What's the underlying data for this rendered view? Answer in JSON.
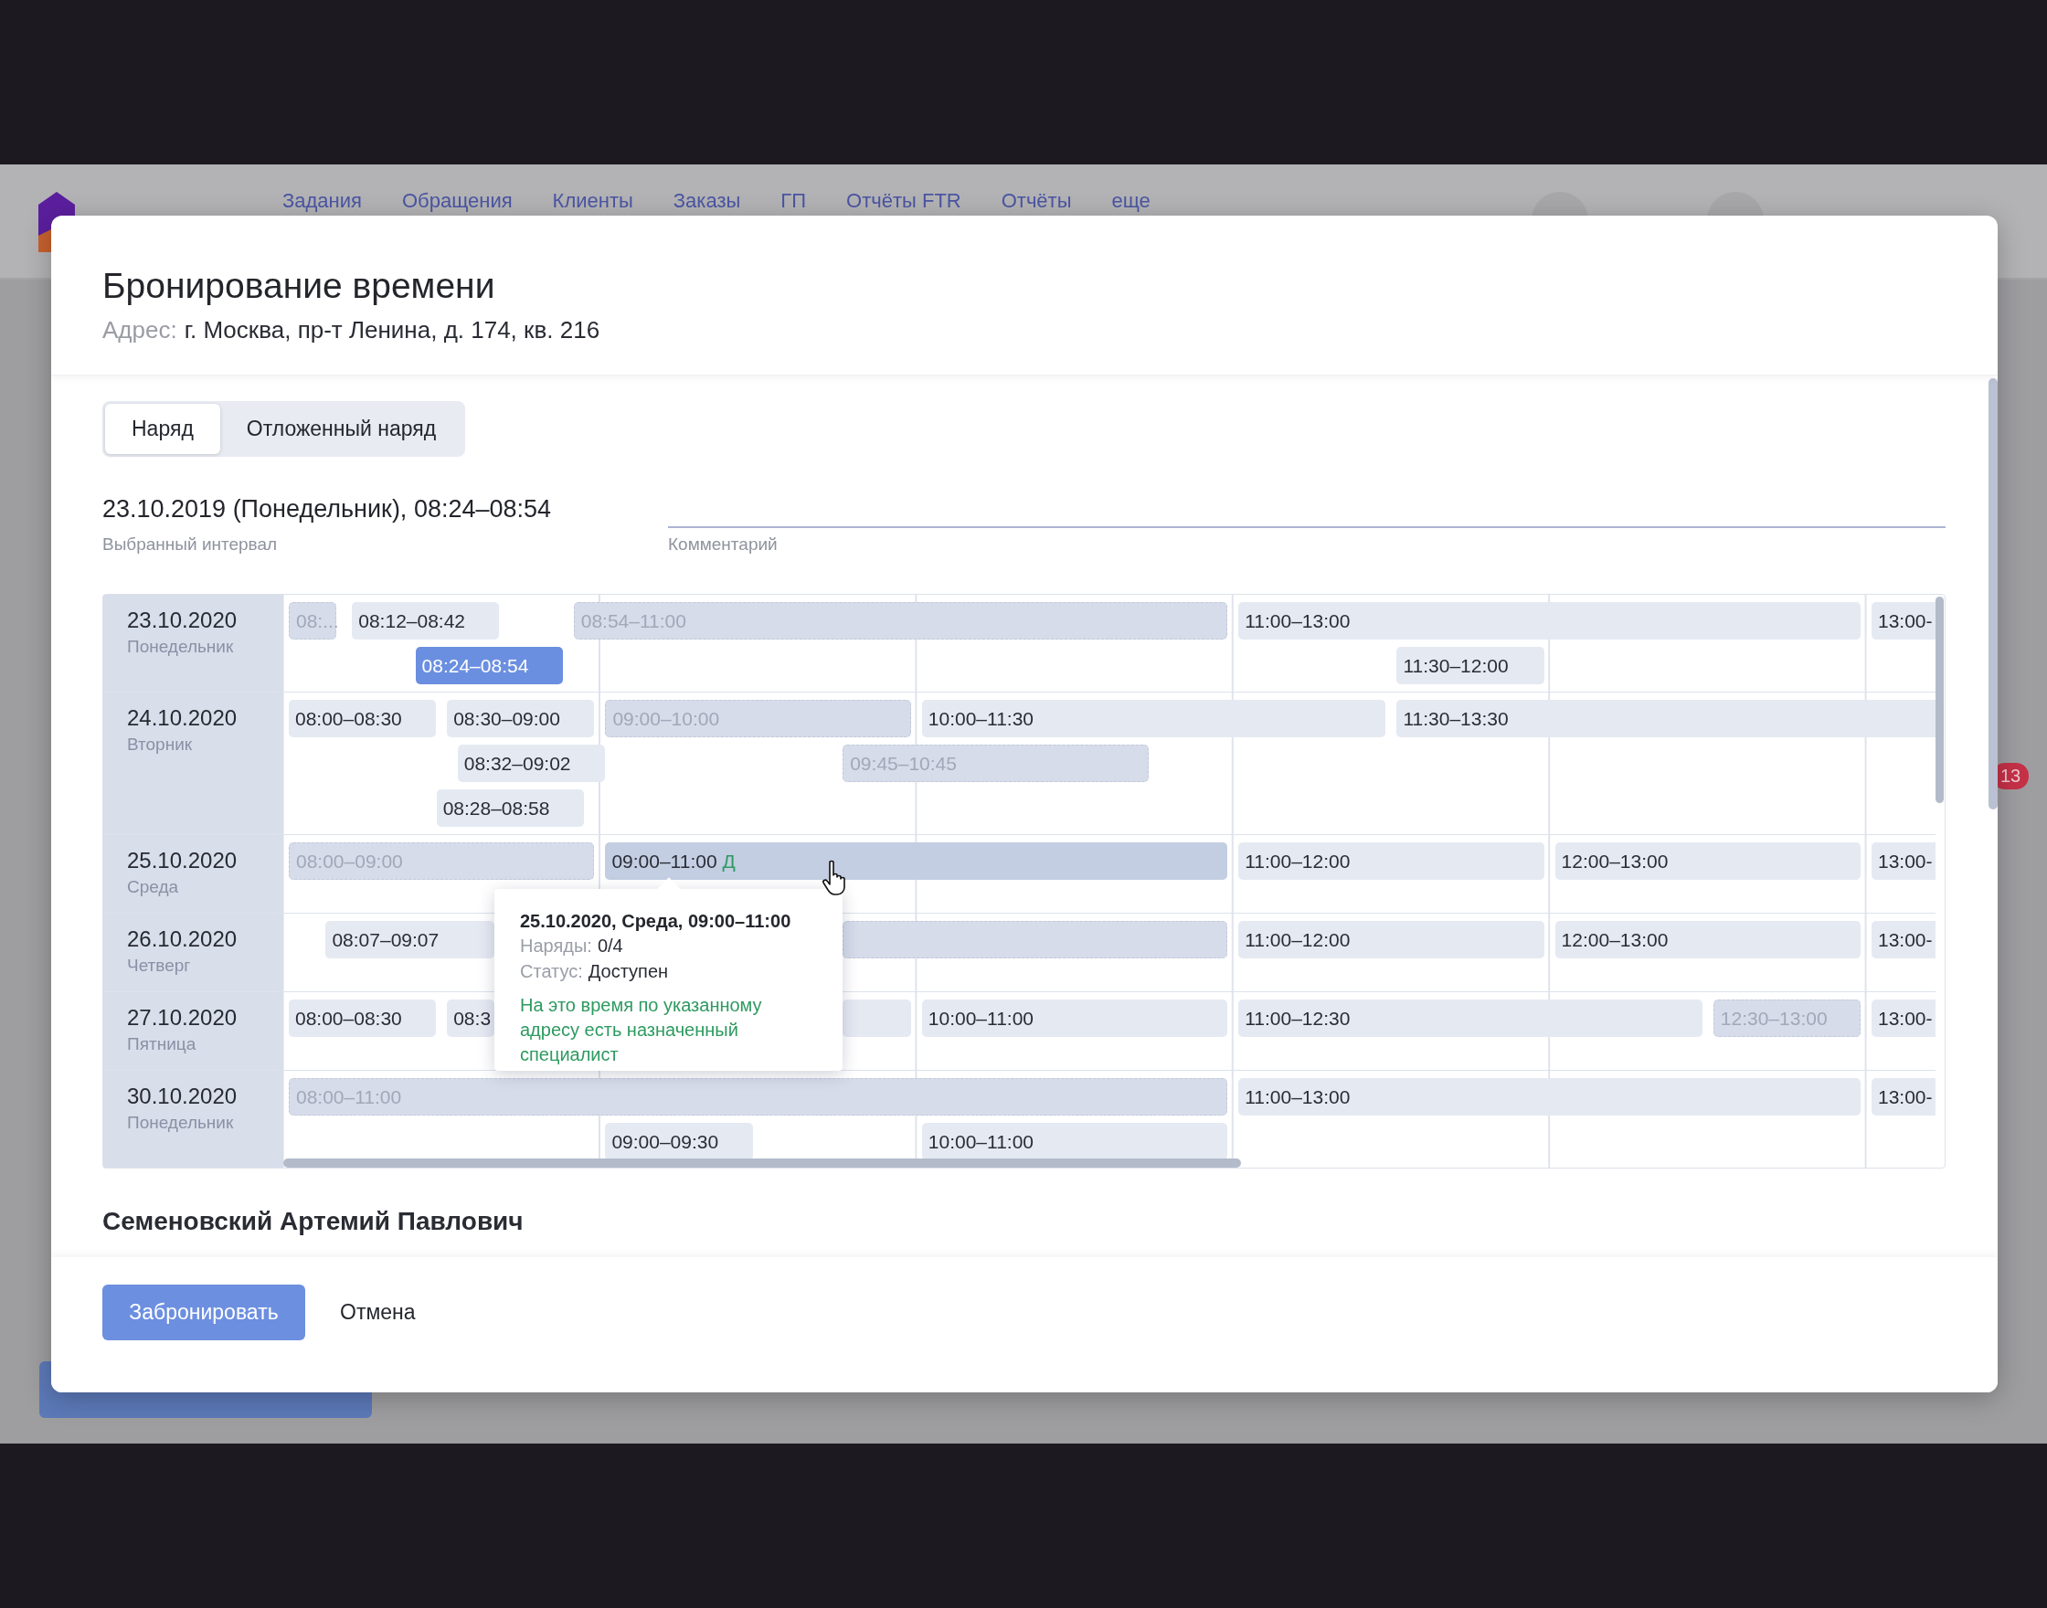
{
  "app_header": {
    "nav": [
      "Задания",
      "Обращения",
      "Клиенты",
      "Заказы",
      "ГП",
      "Отчёты FTR",
      "Отчёты",
      "еще"
    ],
    "notification_badge": "13"
  },
  "modal": {
    "title": "Бронирование времени",
    "address_label": "Адрес:",
    "address": "г. Москва, пр-т Ленина, д. 174, кв. 216",
    "tabs": [
      {
        "label": "Наряд",
        "selected": true
      },
      {
        "label": "Отложенный наряд",
        "selected": false
      }
    ],
    "selected_interval": {
      "value": "23.10.2019 (Понедельник), 08:24–08:54",
      "label": "Выбранный интервал"
    },
    "comment": {
      "label": "Комментарий"
    },
    "schedule": {
      "days": [
        {
          "date": "23.10.2020",
          "weekday": "Понедельник",
          "slots": [
            {
              "label": "08:...",
              "available": false,
              "selected": false,
              "hovered": false
            },
            {
              "label": "08:12–08:42",
              "available": true,
              "selected": false,
              "hovered": false
            },
            {
              "label": "08:54–11:00",
              "available": false,
              "selected": false,
              "hovered": false
            },
            {
              "label": "11:00–13:00",
              "available": true,
              "selected": false,
              "hovered": false
            },
            {
              "label": "13:00-",
              "available": true,
              "selected": false,
              "hovered": false
            },
            {
              "label": "08:24–08:54",
              "available": true,
              "selected": true,
              "hovered": false
            },
            {
              "label": "11:30–12:00",
              "available": true,
              "selected": false,
              "hovered": false
            }
          ]
        },
        {
          "date": "24.10.2020",
          "weekday": "Вторник",
          "slots": [
            {
              "label": "08:00–08:30",
              "available": true,
              "selected": false,
              "hovered": false
            },
            {
              "label": "08:30–09:00",
              "available": true,
              "selected": false,
              "hovered": false
            },
            {
              "label": "09:00–10:00",
              "available": false,
              "selected": false,
              "hovered": false
            },
            {
              "label": "10:00–11:30",
              "available": true,
              "selected": false,
              "hovered": false
            },
            {
              "label": "11:30–13:30",
              "available": true,
              "selected": false,
              "hovered": false
            },
            {
              "label": "08:32–09:02",
              "available": true,
              "selected": false,
              "hovered": false
            },
            {
              "label": "09:45–10:45",
              "available": false,
              "selected": false,
              "hovered": false
            },
            {
              "label": "08:28–08:58",
              "available": true,
              "selected": false,
              "hovered": false
            }
          ]
        },
        {
          "date": "25.10.2020",
          "weekday": "Среда",
          "slots": [
            {
              "label": "08:00–09:00",
              "available": false,
              "selected": false,
              "hovered": false
            },
            {
              "label": "09:00–11:00",
              "tag": "Д",
              "available": true,
              "selected": false,
              "hovered": true
            },
            {
              "label": "11:00–12:00",
              "available": true,
              "selected": false,
              "hovered": false
            },
            {
              "label": "12:00–13:00",
              "available": true,
              "selected": false,
              "hovered": false
            },
            {
              "label": "13:00-",
              "available": true,
              "selected": false,
              "hovered": false
            }
          ]
        },
        {
          "date": "26.10.2020",
          "weekday": "Четверг",
          "slots": [
            {
              "label": "08:07–09:07",
              "available": true,
              "selected": false,
              "hovered": false
            },
            {
              "available": false,
              "selected": false,
              "hovered": false
            },
            {
              "label": "11:00–12:00",
              "available": true,
              "selected": false,
              "hovered": false
            },
            {
              "label": "12:00–13:00",
              "available": true,
              "selected": false,
              "hovered": false
            },
            {
              "label": "13:00-",
              "available": true,
              "selected": false,
              "hovered": false
            }
          ]
        },
        {
          "date": "27.10.2020",
          "weekday": "Пятница",
          "slots": [
            {
              "label": "08:00–08:30",
              "available": true,
              "selected": false,
              "hovered": false
            },
            {
              "label": "08:3",
              "available": true,
              "selected": false,
              "hovered": false
            },
            {
              "available": true,
              "selected": false,
              "hovered": false
            },
            {
              "label": "10:00–11:00",
              "available": true,
              "selected": false,
              "hovered": false
            },
            {
              "label": "11:00–12:30",
              "available": true,
              "selected": false,
              "hovered": false
            },
            {
              "label": "12:30–13:00",
              "available": false,
              "selected": false,
              "hovered": false
            },
            {
              "label": "13:00-",
              "available": true,
              "selected": false,
              "hovered": false
            }
          ]
        },
        {
          "date": "30.10.2020",
          "weekday": "Понедельник",
          "slots": [
            {
              "label": "08:00–11:00",
              "available": false,
              "selected": false,
              "hovered": false
            },
            {
              "label": "11:00–13:00",
              "available": true,
              "selected": false,
              "hovered": false
            },
            {
              "label": "13:00-",
              "available": true,
              "selected": false,
              "hovered": false
            },
            {
              "label": "09:00–09:30",
              "available": true,
              "selected": false,
              "hovered": false
            },
            {
              "label": "10:00–11:00",
              "available": true,
              "selected": false,
              "hovered": false
            }
          ]
        }
      ]
    },
    "tooltip": {
      "title": "25.10.2020, Среда, 09:00–11:00",
      "orders_label": "Наряды:",
      "orders": "0/4",
      "status_label": "Статус:",
      "status": "Доступен",
      "note": "На это время по указанному адресу есть назначенный специалист"
    },
    "specialist": "Семеновский Артемий Павлович",
    "buttons": [
      {
        "label": "Забронировать",
        "kind": "primary"
      },
      {
        "label": "Отмена",
        "kind": "text"
      }
    ]
  }
}
